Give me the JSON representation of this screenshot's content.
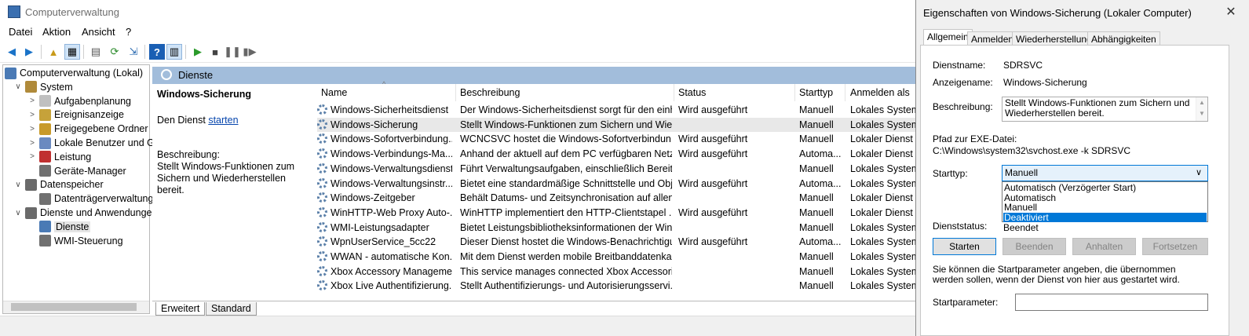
{
  "window": {
    "title": "Computerverwaltung"
  },
  "menu": [
    "Datei",
    "Aktion",
    "Ansicht",
    "?"
  ],
  "tree": [
    {
      "label": "Computerverwaltung (Lokal)",
      "depth": 0,
      "toggle": ""
    },
    {
      "label": "System",
      "depth": 1,
      "toggle": "∨"
    },
    {
      "label": "Aufgabenplanung",
      "depth": 2,
      "toggle": ">"
    },
    {
      "label": "Ereignisanzeige",
      "depth": 2,
      "toggle": ">"
    },
    {
      "label": "Freigegebene Ordner",
      "depth": 2,
      "toggle": ">"
    },
    {
      "label": "Lokale Benutzer und Gru",
      "depth": 2,
      "toggle": ">"
    },
    {
      "label": "Leistung",
      "depth": 2,
      "toggle": ">"
    },
    {
      "label": "Geräte-Manager",
      "depth": 2,
      "toggle": ""
    },
    {
      "label": "Datenspeicher",
      "depth": 1,
      "toggle": "∨"
    },
    {
      "label": "Datenträgerverwaltung",
      "depth": 2,
      "toggle": ""
    },
    {
      "label": "Dienste und Anwendungen",
      "depth": 1,
      "toggle": "∨"
    },
    {
      "label": "Dienste",
      "depth": 2,
      "toggle": "",
      "selected": true
    },
    {
      "label": "WMI-Steuerung",
      "depth": 2,
      "toggle": ""
    }
  ],
  "services_pane": {
    "title": "Dienste",
    "selected_name": "Windows-Sicherung",
    "start_prefix": "Den Dienst ",
    "start_link": "starten",
    "desc_label": "Beschreibung:",
    "desc_text": "Stellt Windows-Funktionen zum Sichern und Wiederherstellen bereit.",
    "columns": [
      "Name",
      "Beschreibung",
      "Status",
      "Starttyp",
      "Anmelden als"
    ],
    "rows": [
      [
        "Windows-Sicherheitsdienst",
        "Der Windows-Sicherheitsdienst sorgt für den einh...",
        "Wird ausgeführt",
        "Manuell",
        "Lokales System"
      ],
      [
        "Windows-Sicherung",
        "Stellt Windows-Funktionen zum Sichern und Wie...",
        "",
        "Manuell",
        "Lokales System"
      ],
      [
        "Windows-Sofortverbindung...",
        "WCNCSVC hostet die Windows-Sofortverbindun...",
        "Wird ausgeführt",
        "Manuell",
        "Lokaler Dienst"
      ],
      [
        "Windows-Verbindungs-Ma...",
        "Anhand der aktuell auf dem PC verfügbaren Netz...",
        "Wird ausgeführt",
        "Automa...",
        "Lokaler Dienst"
      ],
      [
        "Windows-Verwaltungsdienst",
        "Führt Verwaltungsaufgaben, einschließlich Bereits...",
        "",
        "Manuell",
        "Lokales System"
      ],
      [
        "Windows-Verwaltungsinstr...",
        "Bietet eine standardmäßige Schnittstelle und Obj...",
        "Wird ausgeführt",
        "Automa...",
        "Lokales System"
      ],
      [
        "Windows-Zeitgeber",
        "Behält Datums- und Zeitsynchronisation auf allen...",
        "",
        "Manuell",
        "Lokaler Dienst"
      ],
      [
        "WinHTTP-Web Proxy Auto-...",
        "WinHTTP implementiert den HTTP-Clientstapel ...",
        "Wird ausgeführt",
        "Manuell",
        "Lokaler Dienst"
      ],
      [
        "WMI-Leistungsadapter",
        "Bietet Leistungsbibliotheksinformationen der Win...",
        "",
        "Manuell",
        "Lokales System"
      ],
      [
        "WpnUserService_5cc22",
        "Dieser Dienst hostet die Windows-Benachrichtigu...",
        "Wird ausgeführt",
        "Automa...",
        "Lokales System"
      ],
      [
        "WWAN - automatische Kon...",
        "Mit dem Dienst werden mobile Breitbanddatenka...",
        "",
        "Manuell",
        "Lokales System"
      ],
      [
        "Xbox Accessory Manageme...",
        "This service manages connected Xbox Accessories.",
        "",
        "Manuell",
        "Lokales System"
      ],
      [
        "Xbox Live Authentifizierung...",
        "Stellt Authentifizierungs- und Autorisierungsservi...",
        "",
        "Manuell",
        "Lokales System"
      ]
    ],
    "tabs": [
      "Erweitert",
      "Standard"
    ]
  },
  "dialog": {
    "title": "Eigenschaften von Windows-Sicherung (Lokaler Computer)",
    "close": "✕",
    "tabs": [
      "Allgemein",
      "Anmelden",
      "Wiederherstellung",
      "Abhängigkeiten"
    ],
    "service_name_label": "Dienstname:",
    "service_name": "SDRSVC",
    "display_name_label": "Anzeigename:",
    "display_name": "Windows-Sicherung",
    "description_label": "Beschreibung:",
    "description": "Stellt Windows-Funktionen zum Sichern und Wiederherstellen bereit.",
    "exe_path_label": "Pfad zur EXE-Datei:",
    "exe_path": "C:\\Windows\\system32\\svchost.exe -k SDRSVC",
    "startup_label": "Starttyp:",
    "startup_value": "Manuell",
    "startup_options": [
      "Automatisch (Verzögerter Start)",
      "Automatisch",
      "Manuell",
      "Deaktiviert"
    ],
    "startup_highlighted_index": 3,
    "status_label": "Dienststatus:",
    "status_value": "Beendet",
    "buttons": [
      "Starten",
      "Beenden",
      "Anhalten",
      "Fortsetzen"
    ],
    "hint": "Sie können die Startparameter angeben, die übernommen werden sollen, wenn der Dienst von hier aus gestartet wird.",
    "param_label": "Startparameter:"
  },
  "colors": {
    "header_bar": "#a2bddb",
    "selection": "#0078d7"
  }
}
